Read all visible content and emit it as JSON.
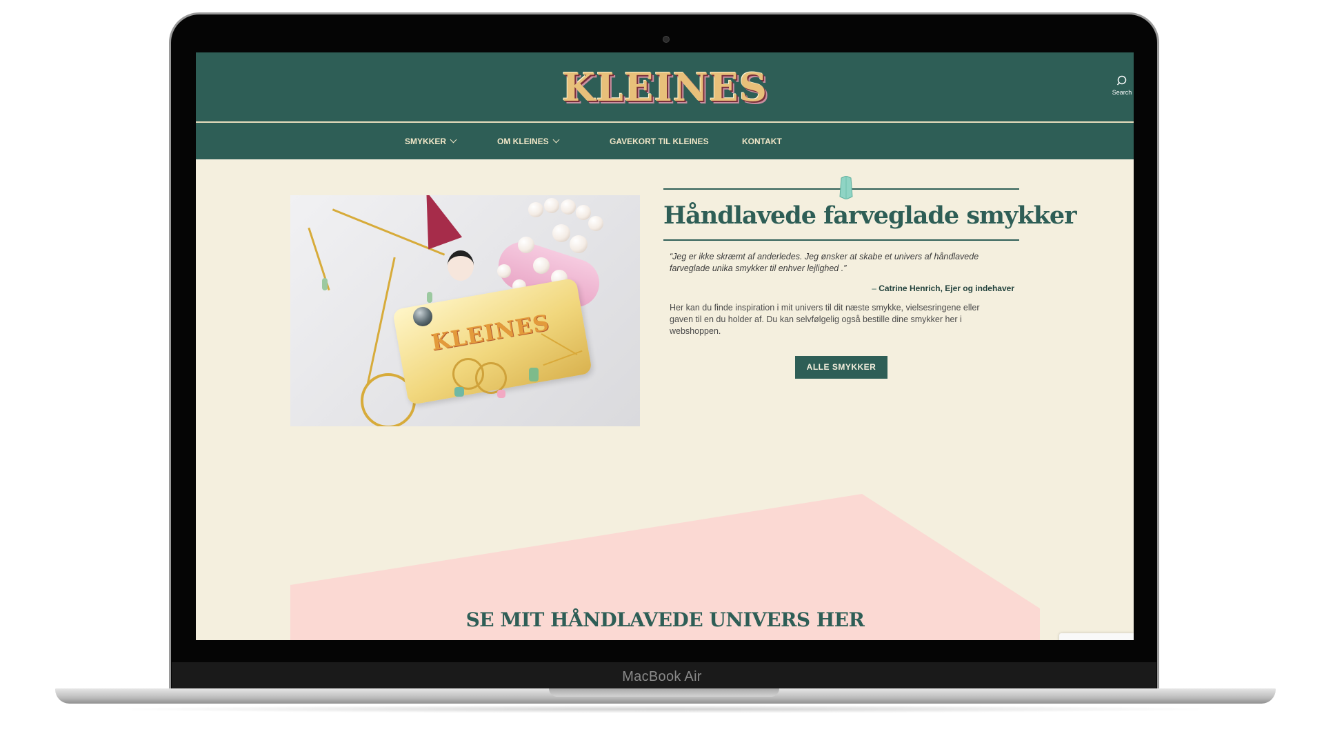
{
  "device": {
    "label": "MacBook Air"
  },
  "header": {
    "logo_text": "KLEINES",
    "search_label": "Search"
  },
  "nav": {
    "items": [
      {
        "label": "SMYKKER",
        "has_dropdown": true
      },
      {
        "label": "OM KLEINES",
        "has_dropdown": true
      },
      {
        "label": "GAVEKORT TIL KLEINES",
        "has_dropdown": false
      },
      {
        "label": "KONTAKT",
        "has_dropdown": false
      }
    ]
  },
  "hero": {
    "image_card_text": "KLEINES",
    "title": "Håndlavede farveglade smykker",
    "quote_line1": "“Jeg er ikke skræmt af anderledes. Jeg ønsker at skabe et univers af håndlavede",
    "quote_line2": "farveglade unika smykker til enhver lejlighed .”",
    "attribution_prefix": "– ",
    "attribution_name": "Catrine Henrich, Ejer og indehaver",
    "body_line1": "Her kan du finde inspiration i mit univers til dit næste smykke, vielsesringene eller",
    "body_line2": "gaven til en du holder af. Du kan selvfølgelig også bestille dine smykker her i",
    "body_line3": "webshoppen.",
    "cta_label": "ALLE SMYKKER"
  },
  "universe": {
    "heading": "SE MIT HÅNDLAVEDE UNIVERS HER"
  },
  "colors": {
    "brand_green": "#2e5e56",
    "cream_background": "#f4efde",
    "pink_section": "#fbd9d3",
    "gold": "#d7ab3a",
    "gem_teal": "#8fd4c4"
  },
  "icons": [
    "search-icon",
    "chevron-down-icon",
    "gem-icon"
  ]
}
